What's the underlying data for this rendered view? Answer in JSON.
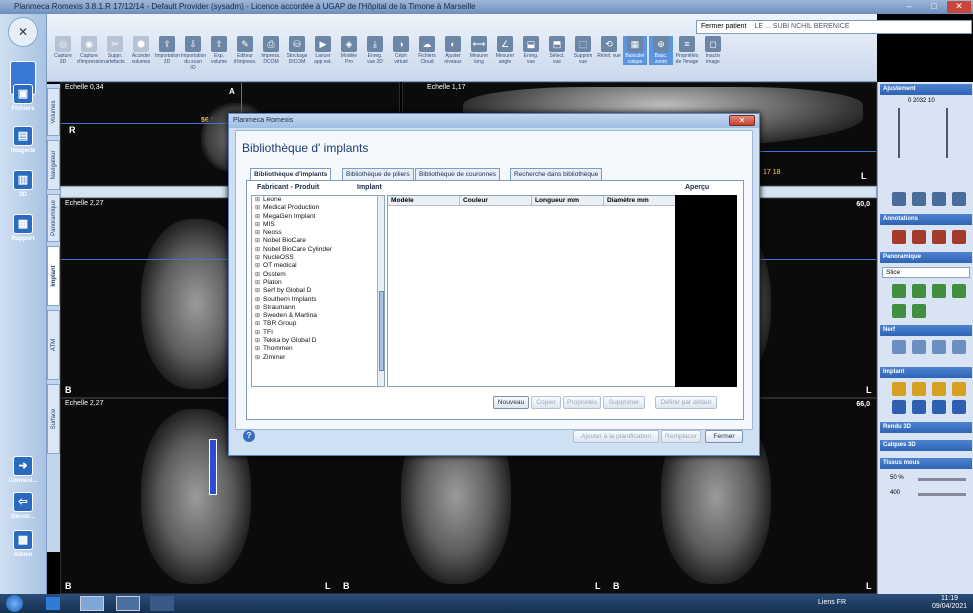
{
  "window": {
    "title": "Planmeca Romexis 3.8.1.R  17/12/14 - Default Provider (sysadm) - Licence accordée à UGAP de l'Hôpital de la Timone à Marseille",
    "min": "–",
    "max": "□",
    "close": "✕"
  },
  "toolbar": {
    "items": [
      {
        "label": "Capture 3D",
        "icon": "capture-3d-icon"
      },
      {
        "label": "Capture d'impression",
        "icon": "capture-impression-icon"
      },
      {
        "label": "Suppr. artefacts",
        "icon": "artifact-remove-icon"
      },
      {
        "label": "Accéder volumes",
        "icon": "volumes-icon"
      },
      {
        "label": "Importation 3D",
        "icon": "import-3d-icon"
      },
      {
        "label": "Importation du scan IO",
        "icon": "import-io-icon"
      },
      {
        "label": "Exp. volume",
        "icon": "export-volume-icon"
      },
      {
        "label": "Editeur d'impress.",
        "icon": "print-editor-icon"
      },
      {
        "label": "Impress. DCOM",
        "icon": "print-dicom-icon"
      },
      {
        "label": "Stockage DICOM",
        "icon": "dicom-storage-icon"
      },
      {
        "label": "Lancer app ext.",
        "icon": "launch-app-icon"
      },
      {
        "label": "Modèle Pro",
        "icon": "model-pro-icon"
      },
      {
        "label": "Enreg. vue 2D",
        "icon": "save-2d-icon"
      },
      {
        "label": "Céph virtuel",
        "icon": "ceph-icon"
      },
      {
        "label": "Fichiers Cloud",
        "icon": "cloud-icon"
      },
      {
        "label": "Ajuster niveaux",
        "icon": "levels-icon"
      },
      {
        "label": "Mesurer long",
        "icon": "measure-length-icon"
      },
      {
        "label": "Mesurer angle",
        "icon": "measure-angle-icon"
      },
      {
        "label": "Enreg. vue",
        "icon": "save-view-icon"
      },
      {
        "label": "Sélect. vue",
        "icon": "select-view-icon"
      },
      {
        "label": "Supprim vue",
        "icon": "delete-view-icon"
      },
      {
        "label": "Réinit. vue",
        "icon": "reset-view-icon"
      },
      {
        "label": "Basculer calque",
        "icon": "toggle-layer-icon"
      },
      {
        "label": "Basc. zoom",
        "icon": "toggle-zoom-icon"
      },
      {
        "label": "Propriétés de l'image",
        "icon": "properties-icon"
      },
      {
        "label": "Inactiv image",
        "icon": "deactivate-icon"
      }
    ],
    "fermer_patient": "Fermer patient",
    "patient_name": "LE ... SUBI NCHIL BERENICE"
  },
  "left_rail": [
    {
      "label": "Fichiers",
      "icon": "files-icon"
    },
    {
      "label": "Imagerie",
      "icon": "imaging-icon"
    },
    {
      "label": "3D",
      "icon": "3d-icon"
    },
    {
      "label": "Rapport",
      "icon": "report-icon"
    },
    {
      "label": "Connexi...",
      "icon": "login-icon"
    },
    {
      "label": "Décon...",
      "icon": "logout-icon"
    },
    {
      "label": "Admin",
      "icon": "admin-icon"
    }
  ],
  "left_tabs": [
    "Volumes",
    "Navigateur",
    "Panoramique",
    "Implant",
    "ATM",
    "Surface"
  ],
  "viewports": {
    "top_left_scale": "Echelle 0,34",
    "top_left_orient": "A",
    "top_left_r": "R",
    "top_left_value": "56,0",
    "top_right_scale": "Echelle 1,17",
    "top_right_nums": "17  18",
    "mid_scale": "Echelle 2,27",
    "mid_value": "60,0",
    "bottom_scale": "Echelle 2,27",
    "bottom_value": "66,0",
    "marker_b": "B",
    "marker_l": "L"
  },
  "right_panel": {
    "ajustement": "Ajustement",
    "ajust_values": "0  2032  10",
    "annotations": "Annotations",
    "panoramique": "Panoramique",
    "slice_select": "Slice",
    "nerf": "Nerf",
    "implant": "Implant",
    "rendu3d": "Rendu 3D",
    "calques3d": "Calques 3D",
    "tissus_mous": "Tissus mous",
    "pct": "50 %",
    "num400": "400"
  },
  "dialog": {
    "title": "Planmeca Romexis",
    "heading": "Bibliothèque d' implants",
    "tabs": [
      "Bibliothèque d'implants",
      "Bibliothèque de piliers",
      "Bibliothèque de couronnes",
      "Recherche dans bibliothèque"
    ],
    "col_fabricant": "Fabricant - Produit",
    "col_implant": "Implant",
    "col_apercu": "Aperçu",
    "grid_headers": [
      "Modèle",
      "Couleur",
      "Longueur mm",
      "Diamètre mm"
    ],
    "manufacturers": [
      "Leone",
      "Medical Production",
      "MegaGen Implant",
      "MIS",
      "Neoss",
      "Nobel BioCare",
      "Nobel BioCare Cylinder",
      "NucleOSS",
      "OT medical",
      "Osstem",
      "Platon",
      "Serf by Global D",
      "Southern Implants",
      "Straumann",
      "Sweden & Martina",
      "TBR Group",
      "TFI",
      "Tekka by Global D",
      "Thommen",
      "Zimmer"
    ],
    "btn_nouveau": "Nouveau",
    "btn_copier": "Copier",
    "btn_proprietes": "Propriétés",
    "btn_supprimer": "Supprimer",
    "btn_defaut": "Définir par défaut",
    "btn_ajouter": "Ajouter à la planification",
    "btn_remplacer": "Remplacer",
    "btn_fermer": "Fermer",
    "help": "?"
  },
  "taskbar": {
    "lang": "Liens  FR",
    "time": "11:19",
    "date": "09/04/2021"
  }
}
